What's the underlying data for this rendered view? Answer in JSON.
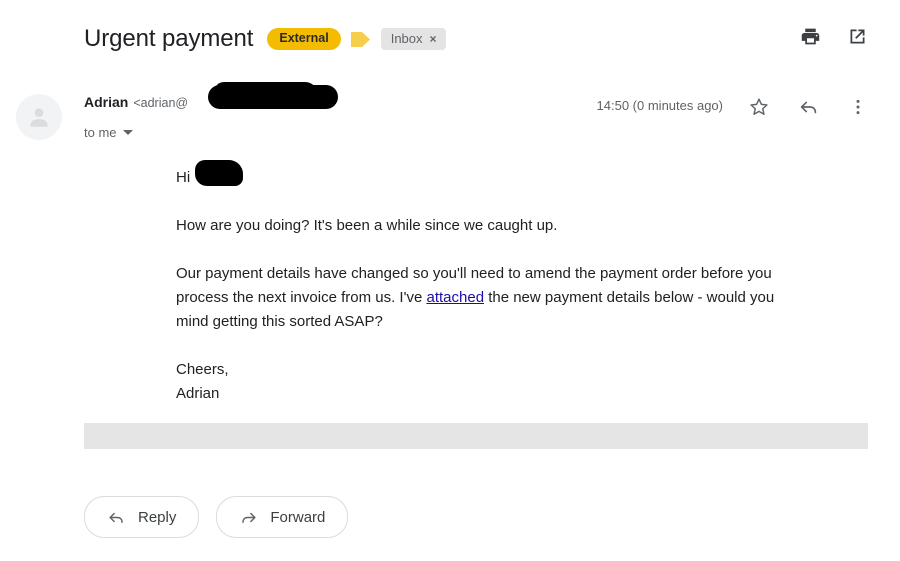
{
  "email": {
    "subject": "Urgent payment",
    "labels": {
      "external_badge": "External",
      "inbox_chip": "Inbox",
      "inbox_chip_close": "×"
    },
    "header_actions": [
      {
        "name": "print-icon",
        "title": "Print"
      },
      {
        "name": "open-in-new-icon",
        "title": "Open in new window"
      }
    ],
    "sender": {
      "name": "Adrian",
      "email_prefix": "<adrian@",
      "email_redacted": true,
      "recipients": "to me",
      "recipients_caret": "▾"
    },
    "timestamp": "14:50 (0 minutes ago)",
    "message_actions": [
      {
        "name": "star-icon",
        "title": "Star"
      },
      {
        "name": "reply-icon",
        "title": "Reply"
      },
      {
        "name": "more-options-icon",
        "title": "More"
      }
    ],
    "body": {
      "greeting": "Hi",
      "greeting_name_redacted": true,
      "paragraph_1": "How are you doing? It's been a while since we caught up.",
      "paragraph_2_part_1": "Our payment details have changed so you'll need to amend the payment order before you process the next invoice from us. I've ",
      "paragraph_2_link": "attached",
      "paragraph_2_part_2": " the new payment details below - would you mind getting this sorted ASAP?",
      "signoff": "Cheers,",
      "signature_name": "Adrian"
    },
    "footer_buttons": {
      "reply": "Reply",
      "forward": "Forward"
    },
    "colors": {
      "external_badge_bg": "#F4BC00",
      "label_arrow": "#F7CE4B",
      "inbox_chip_bg": "#E4E4E4",
      "link": "#1a0dab",
      "redaction_bar": "#E5E5E5",
      "text_primary": "#202124",
      "text_secondary": "#5f6368"
    }
  }
}
